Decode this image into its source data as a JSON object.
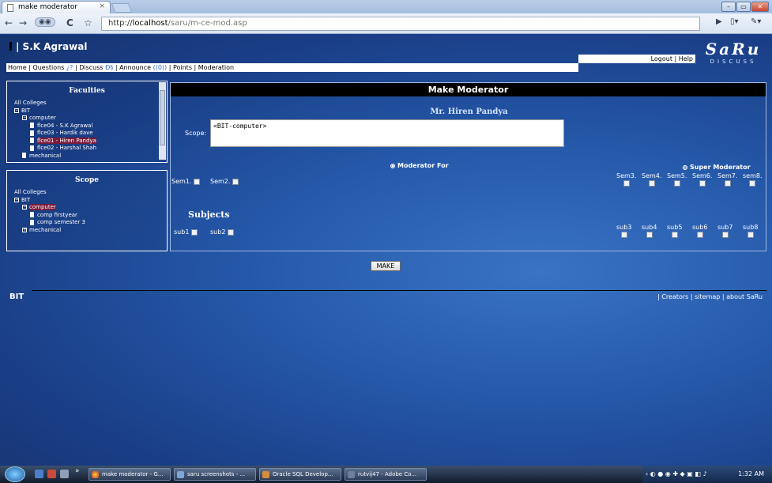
{
  "browser": {
    "tab_title": "make moderator",
    "tab_close": "×",
    "url_prefix": "http://",
    "url_host": "localhost",
    "url_path": "/saru/m-ce-mod.asp"
  },
  "header": {
    "user": "| S.K Agrawal",
    "logo_main": "SaRu",
    "logo_sub": "DISCUSS",
    "logout": "Logout",
    "help": "Help"
  },
  "menu": {
    "home": "Home",
    "questions": "Questions",
    "questions_sym": "¿?",
    "discuss": "Discuss",
    "discuss_sym": "Ð§",
    "announce": "Announce",
    "announce_sym": "((0))",
    "points": "Points",
    "moderation": "Moderation"
  },
  "faculties": {
    "title": "Faculties",
    "all": "All Colleges",
    "college": "BIT",
    "dept": "computer",
    "items": [
      "flce04 - S.K Agrawal",
      "flce03 - Hardik dave",
      "flce01 - Hiren Pandya",
      "flce02 - Harshal Shah"
    ],
    "other": "mechanical"
  },
  "scope_panel": {
    "title": "Scope",
    "all": "All Colleges",
    "college": "BIT",
    "dept": "computer",
    "items": [
      "comp firstyear",
      "comp semester 3"
    ],
    "other": "mechanical"
  },
  "main": {
    "title": "Make Moderator",
    "moderator_name": "Mr. Hiren Pandya",
    "scope_label": "Scope:",
    "scope_value": "<BIT-computer>",
    "moderator_for": "Moderator For",
    "super_moderator": "Super Moderator",
    "sem_left": [
      "Sem1.",
      "Sem2."
    ],
    "sem_right": [
      "Sem3.",
      "Sem4.",
      "Sem5.",
      "Sem6.",
      "Sem7.",
      "sem8."
    ],
    "subjects_title": "Subjects",
    "sub_left": [
      "sub1",
      "sub2"
    ],
    "sub_right": [
      "sub3",
      "sub4",
      "sub5",
      "sub6",
      "sub7",
      "sub8"
    ],
    "make_button": "MAKE"
  },
  "footer": {
    "left": "BIT",
    "links": "| Creators | sitemap | about SaRu"
  },
  "taskbar": {
    "items": [
      "make moderator - G...",
      "saru screenshots - ...",
      "Oracle SQL Develop...",
      "rutvij47 - Adobe Co..."
    ],
    "clock": "1:32 AM"
  }
}
